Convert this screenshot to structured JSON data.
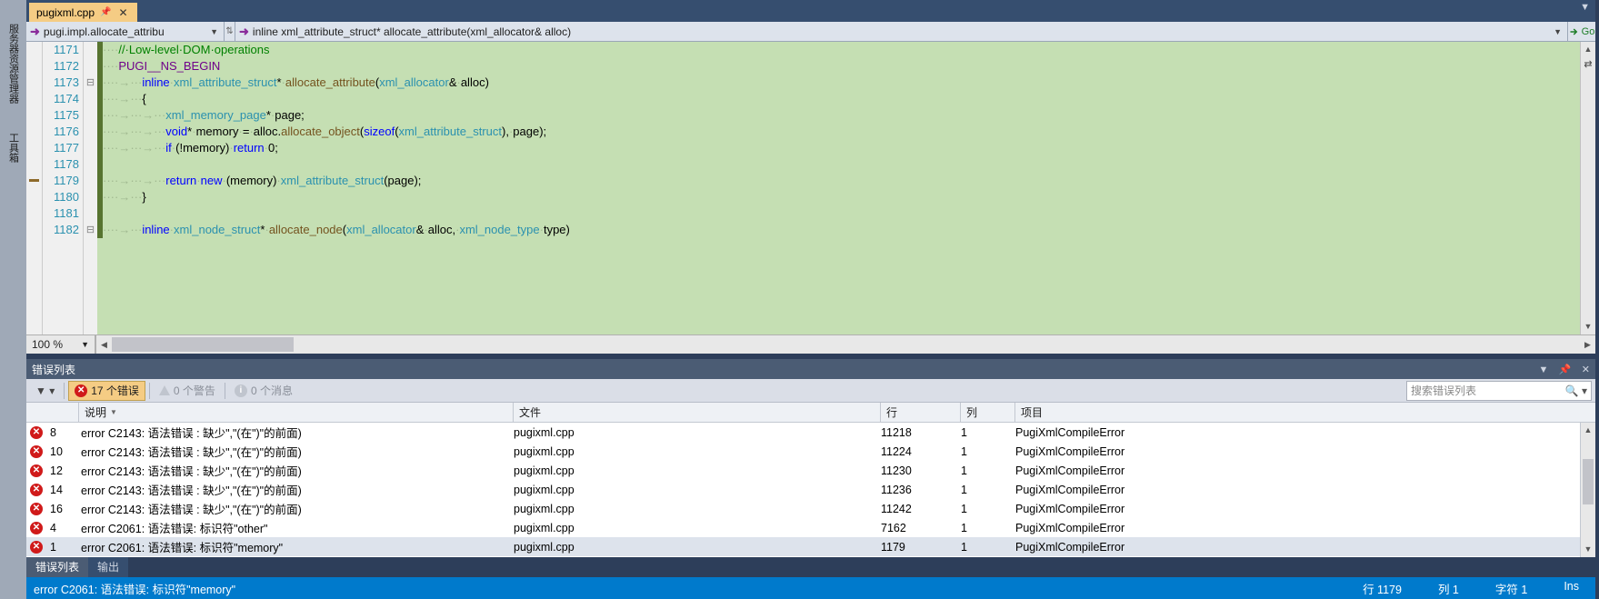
{
  "sidebar": {
    "tab1": "服务器资源管理器",
    "tab2": "工具箱"
  },
  "file_tab": {
    "name": "pugixml.cpp",
    "pin": "📌",
    "close": "✕"
  },
  "nav": {
    "scope": "pugi.impl.allocate_attribu",
    "member": "inline xml_attribute_struct* allocate_attribute(xml_allocator& alloc)",
    "go": "Go"
  },
  "code": {
    "lines": [
      {
        "n": "1171",
        "fold": "",
        "html": "<span class='ws-dot'>····</span><span class='c-comment'>//·Low-level·DOM·operations</span>"
      },
      {
        "n": "1172",
        "fold": "",
        "html": "<span class='ws-dot'>····</span><span class='c-macro'>PUGI__NS_BEGIN</span>"
      },
      {
        "n": "1173",
        "fold": "⊟",
        "html": "<span class='ws-dot'>····→···</span><span class='c-kw'>inline</span><span class='ws-dot'>·</span><span class='c-type'>xml_attribute_struct</span>*<span class='ws-dot'>·</span><span class='c-func'>allocate_attribute</span>(<span class='c-type'>xml_allocator</span>&amp;<span class='ws-dot'>·</span>alloc)"
      },
      {
        "n": "1174",
        "fold": "",
        "html": "<span class='ws-dot'>····→···</span>{"
      },
      {
        "n": "1175",
        "fold": "",
        "html": "<span class='ws-dot'>····→···→···</span><span class='c-type'>xml_memory_page</span>*<span class='ws-dot'>·</span>page;"
      },
      {
        "n": "1176",
        "fold": "",
        "html": "<span class='ws-dot'>····→···→···</span><span class='c-kw'>void</span>*<span class='ws-dot'>·</span>memory<span class='ws-dot'>·</span>=<span class='ws-dot'>·</span>alloc.<span class='c-func'>allocate_object</span>(<span class='c-kw'>sizeof</span>(<span class='c-type'>xml_attribute_struct</span>),<span class='ws-dot'>·</span>page);"
      },
      {
        "n": "1177",
        "fold": "",
        "html": "<span class='ws-dot'>····→···→···</span><span class='c-kw'>if</span><span class='ws-dot'>·</span>(!memory)<span class='ws-dot'>·</span><span class='c-kw'>return</span><span class='ws-dot'>·</span>0;"
      },
      {
        "n": "1178",
        "fold": "",
        "html": ""
      },
      {
        "n": "1179",
        "fold": "",
        "html": "<span class='ws-dot'>····→···→···</span><span class='c-kw'>return</span><span class='ws-dot'>·</span><span class='c-kw'>new</span><span class='ws-dot'>·</span>(memory)<span class='ws-dot'>·</span><span class='c-type'>xml_attribute_struct</span>(page);"
      },
      {
        "n": "1180",
        "fold": "",
        "html": "<span class='ws-dot'>····→···</span>}"
      },
      {
        "n": "1181",
        "fold": "",
        "html": ""
      },
      {
        "n": "1182",
        "fold": "⊟",
        "html": "<span class='ws-dot'>····→···</span><span class='c-kw'>inline</span><span class='ws-dot'>·</span><span class='c-type'>xml_node_struct</span>*<span class='ws-dot'>·</span><span class='c-func'>allocate_node</span>(<span class='c-type'>xml_allocator</span>&amp;<span class='ws-dot'>·</span>alloc,<span class='ws-dot'>·</span><span class='c-type'>xml_node_type</span><span class='ws-dot'>·</span>type)"
      }
    ]
  },
  "zoom": "100 %",
  "error_panel": {
    "title": "错误列表",
    "errors_label": "17 个错误",
    "warnings_label": "0 个警告",
    "messages_label": "0 个消息",
    "search_placeholder": "搜索错误列表",
    "columns": {
      "desc": "说明",
      "file": "文件",
      "line": "行",
      "col": "列",
      "proj": "项目"
    },
    "rows": [
      {
        "n": "8",
        "desc": "error C2143: 语法错误 : 缺少\",\"(在\")\"的前面)",
        "file": "pugixml.cpp",
        "line": "11218",
        "col": "1",
        "proj": "PugiXmlCompileError"
      },
      {
        "n": "10",
        "desc": "error C2143: 语法错误 : 缺少\",\"(在\")\"的前面)",
        "file": "pugixml.cpp",
        "line": "11224",
        "col": "1",
        "proj": "PugiXmlCompileError"
      },
      {
        "n": "12",
        "desc": "error C2143: 语法错误 : 缺少\",\"(在\")\"的前面)",
        "file": "pugixml.cpp",
        "line": "11230",
        "col": "1",
        "proj": "PugiXmlCompileError"
      },
      {
        "n": "14",
        "desc": "error C2143: 语法错误 : 缺少\",\"(在\")\"的前面)",
        "file": "pugixml.cpp",
        "line": "11236",
        "col": "1",
        "proj": "PugiXmlCompileError"
      },
      {
        "n": "16",
        "desc": "error C2143: 语法错误 : 缺少\",\"(在\")\"的前面)",
        "file": "pugixml.cpp",
        "line": "11242",
        "col": "1",
        "proj": "PugiXmlCompileError"
      },
      {
        "n": "4",
        "desc": "error C2061: 语法错误: 标识符\"other\"",
        "file": "pugixml.cpp",
        "line": "7162",
        "col": "1",
        "proj": "PugiXmlCompileError"
      },
      {
        "n": "1",
        "desc": "error C2061: 语法错误: 标识符\"memory\"",
        "file": "pugixml.cpp",
        "line": "1179",
        "col": "1",
        "proj": "PugiXmlCompileError",
        "selected": true
      }
    ]
  },
  "bottom_tabs": {
    "t1": "错误列表",
    "t2": "输出"
  },
  "status": {
    "message": "error C2061: 语法错误: 标识符\"memory\"",
    "line": "行 1179",
    "col": "列 1",
    "char": "字符 1",
    "ins": "Ins"
  }
}
